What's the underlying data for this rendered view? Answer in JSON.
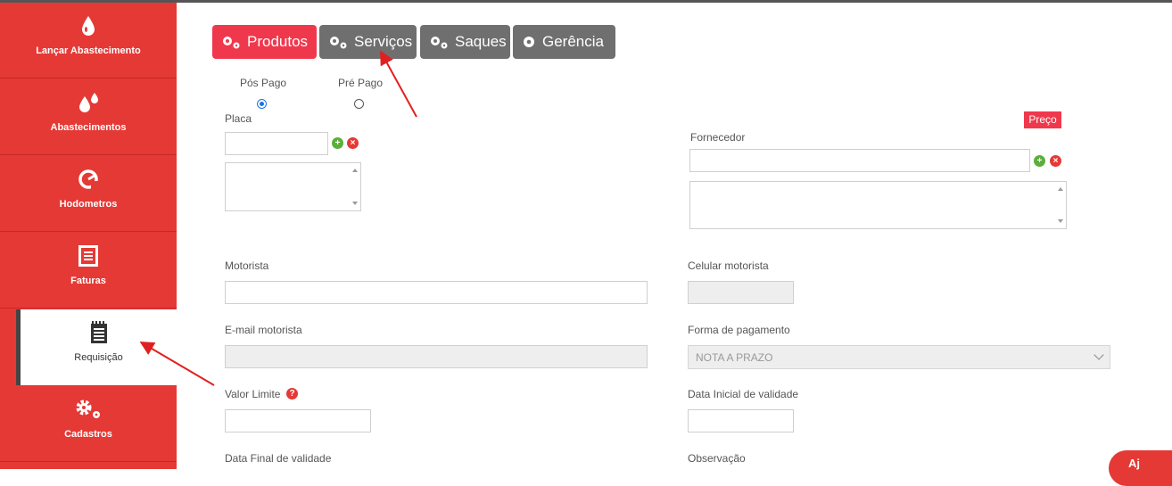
{
  "sidebar": {
    "items": [
      {
        "label": "Lançar Abastecimento",
        "icon": "drop-icon"
      },
      {
        "label": "Abastecimentos",
        "icon": "drops-icon"
      },
      {
        "label": "Hodometros",
        "icon": "gauge-icon"
      },
      {
        "label": "Faturas",
        "icon": "invoice-icon"
      },
      {
        "label": "Requisição",
        "icon": "requisition-icon",
        "active": true
      },
      {
        "label": "Cadastros",
        "icon": "gears-icon"
      }
    ]
  },
  "tabs": [
    {
      "label": "Produtos",
      "icon": "gears-icon",
      "active": true
    },
    {
      "label": "Serviços",
      "icon": "gears-icon"
    },
    {
      "label": "Saques",
      "icon": "gears-icon"
    },
    {
      "label": "Gerência",
      "icon": "gear-icon"
    }
  ],
  "form": {
    "payment_type": {
      "options": [
        "Pós Pago",
        "Pré Pago"
      ],
      "selected": "Pós Pago"
    },
    "placa_label": "Placa",
    "preco_badge": "Preço",
    "fornecedor_label": "Fornecedor",
    "motorista_label": "Motorista",
    "celular_label": "Celular motorista",
    "email_label": "E-mail motorista",
    "forma_pagamento_label": "Forma de pagamento",
    "forma_pagamento_value": "NOTA A PRAZO",
    "valor_limite_label": "Valor Limite",
    "data_inicial_label": "Data Inicial de validade",
    "data_final_label": "Data Final de validade",
    "observacao_label": "Observação"
  },
  "help_bubble": {
    "label": "Aj"
  },
  "colors": {
    "brand_red": "#e53935",
    "tab_active": "#f0384d",
    "tab_inactive": "#6f6f6f"
  }
}
